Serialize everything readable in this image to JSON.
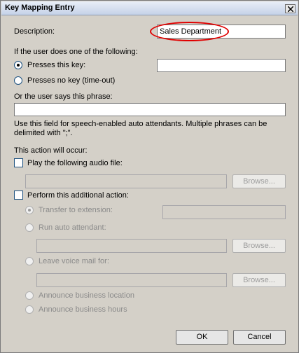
{
  "window": {
    "title": "Key Mapping Entry"
  },
  "description": {
    "label": "Description:",
    "value": "Sales Department"
  },
  "trigger": {
    "heading": "If the user does one of the following:",
    "presses_key_label": "Presses this key:",
    "presses_key_value": "",
    "presses_no_key_label": "Presses no key (time-out)",
    "phrase_heading": "Or the user says this phrase:",
    "phrase_value": "",
    "phrase_hint_line1": "Use this field for speech-enabled auto attendants. Multiple phrases can be",
    "phrase_hint_line2": "delimited with \";\"."
  },
  "action": {
    "heading": "This action will occur:",
    "play_audio_label": "Play the following audio file:",
    "audio_file_value": "",
    "browse_label": "Browse...",
    "additional_action_label": "Perform this additional action:",
    "transfer_label": "Transfer to extension:",
    "transfer_value": "",
    "run_auto_attendant_label": "Run auto attendant:",
    "auto_attendant_value": "",
    "leave_voicemail_label": "Leave voice mail for:",
    "voicemail_value": "",
    "announce_location_label": "Announce business location",
    "announce_hours_label": "Announce business hours"
  },
  "footer": {
    "ok_label": "OK",
    "cancel_label": "Cancel"
  },
  "colors": {
    "highlight": "#e00000",
    "dialog_bg": "#d4d0c8"
  }
}
